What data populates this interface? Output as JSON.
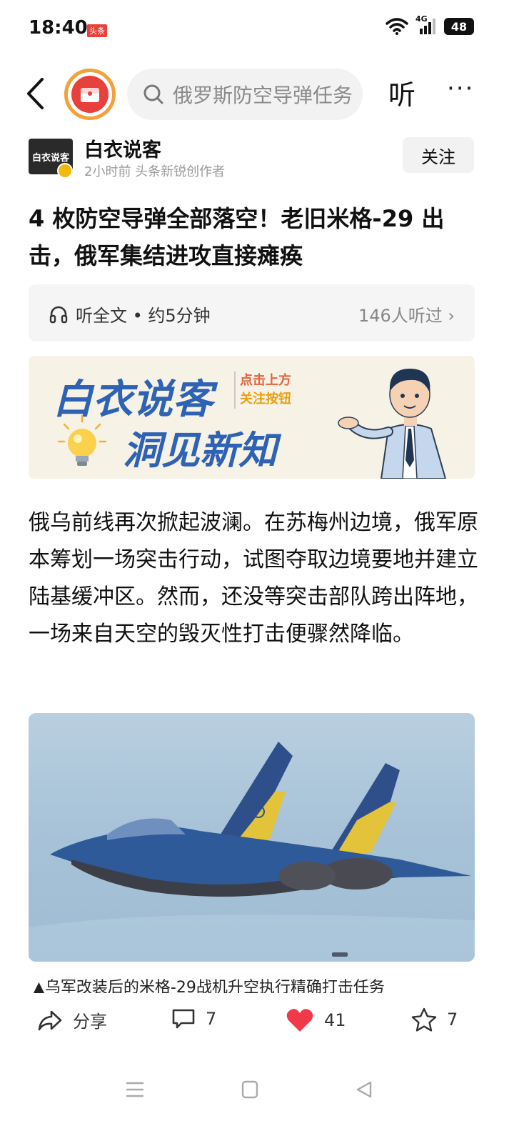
{
  "status_bar": {
    "time": "18:40",
    "app_badge": "头条",
    "network": "4G",
    "battery": "48"
  },
  "top_nav": {
    "search_placeholder": "俄罗斯防空导弹任务",
    "listen_label": "听",
    "more_label": "···"
  },
  "author": {
    "avatar_text": "白衣说客",
    "name": "白衣说客",
    "meta": "2小时前  头条新锐创作者",
    "follow_label": "关注"
  },
  "article": {
    "title": "4 枚防空导弹全部落空！老旧米格-29 出击，俄军集结进攻直接瘫痪",
    "listen_card": {
      "left_text": "听全文 • 约5分钟",
      "right_text": "146人听过 ›"
    },
    "banner": {
      "title_line1": "白衣说客",
      "title_line2": "洞见新知",
      "note_line1": "点击上方",
      "note_line2": "关注按钮"
    },
    "body": "俄乌前线再次掀起波澜。在苏梅州边境，俄军原本筹划一场突击行动，试图夺取边境要地并建立陆基缓冲区。然而，还没等突击部队跨出阵地，一场来自天空的毁灭性打击便骤然降临。",
    "caption": "▲乌军改装后的米格-29战机升空执行精确打击任务"
  },
  "actions": {
    "share_label": "分享",
    "comment_count": "7",
    "like_count": "41",
    "favorite_count": "7"
  },
  "colors": {
    "accent_red": "#e8403a",
    "banner_blue": "#2e62b5",
    "like_red": "#f03a4a"
  }
}
